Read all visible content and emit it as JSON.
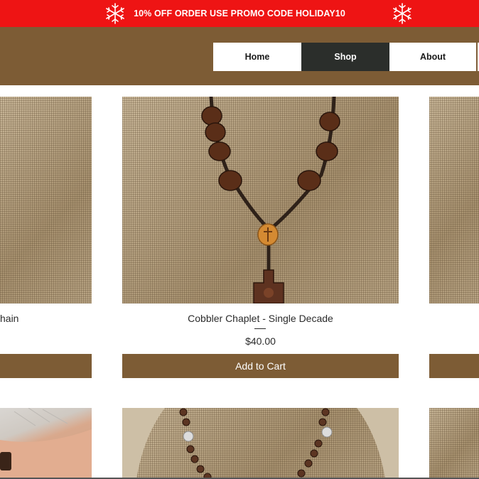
{
  "promo": {
    "text": "10% OFF ORDER USE PROMO CODE HOLIDAY10",
    "background": "#ee1414",
    "icons": [
      "snowflake-icon",
      "snowflake-icon"
    ]
  },
  "header": {
    "background": "#7d5c35",
    "nav": [
      {
        "label": "Home",
        "active": false
      },
      {
        "label": "Shop",
        "active": true
      },
      {
        "label": "About",
        "active": false
      }
    ]
  },
  "products": [
    {
      "title_partial": "hain",
      "price": "",
      "cart_label": ""
    },
    {
      "title": "Cobbler Chaplet - Single Decade",
      "price": "$40.00",
      "cart_label": "Add to Cart"
    },
    {
      "title": "",
      "price": "",
      "cart_label": ""
    }
  ],
  "colors": {
    "accent": "#7d5c35",
    "active_nav": "#2b2e2b",
    "promo": "#ee1414"
  }
}
